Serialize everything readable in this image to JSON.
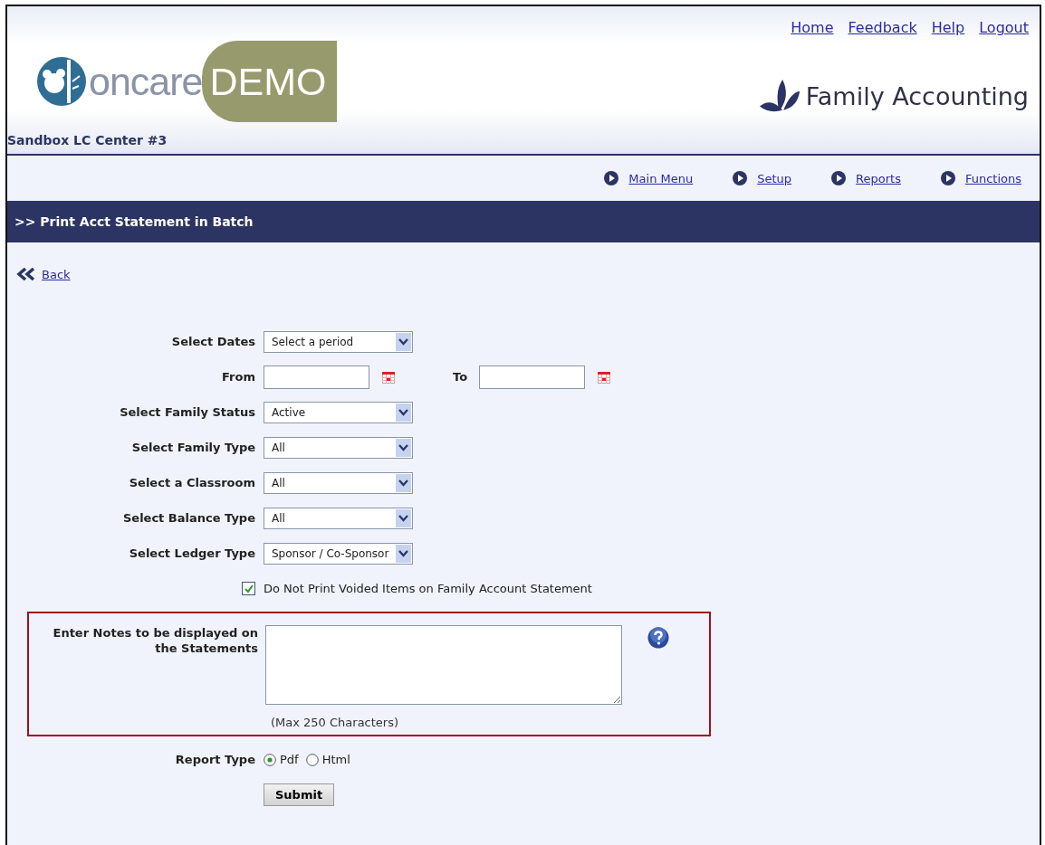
{
  "top_links": [
    "Home",
    "Feedback",
    "Help",
    "Logout"
  ],
  "logo": {
    "word": "oncare",
    "badge": "DEMO"
  },
  "product": "Family Accounting",
  "center_name": "Sandbox LC Center #3",
  "nav": [
    "Main Menu",
    "Setup",
    "Reports",
    "Functions"
  ],
  "page_title": ">> Print Acct Statement in Batch",
  "back_link": "Back",
  "fields": [
    {
      "kind": "select",
      "label": "Select Dates",
      "value": "Select a period"
    },
    {
      "kind": "daterange",
      "from_label": "From",
      "to_label": "To"
    },
    {
      "kind": "select",
      "label": "Select Family Status",
      "value": "Active"
    },
    {
      "kind": "select",
      "label": "Select Family Type",
      "value": "All"
    },
    {
      "kind": "select",
      "label": "Select a Classroom",
      "value": "All"
    },
    {
      "kind": "select",
      "label": "Select Balance Type",
      "value": "All"
    },
    {
      "kind": "select",
      "label": "Select Ledger Type",
      "value": "Sponsor / Co-Sponsor"
    }
  ],
  "voided_option": {
    "label": "Do Not Print Voided Items on Family Account Statement",
    "checked": true
  },
  "notes": {
    "label": "Enter Notes to be displayed on the Statements",
    "hint": "(Max 250 Characters)"
  },
  "report_type": {
    "label": "Report Type",
    "options": [
      {
        "label": "Pdf",
        "selected": true
      },
      {
        "label": "Html",
        "selected": false
      }
    ]
  },
  "submit": "Submit"
}
